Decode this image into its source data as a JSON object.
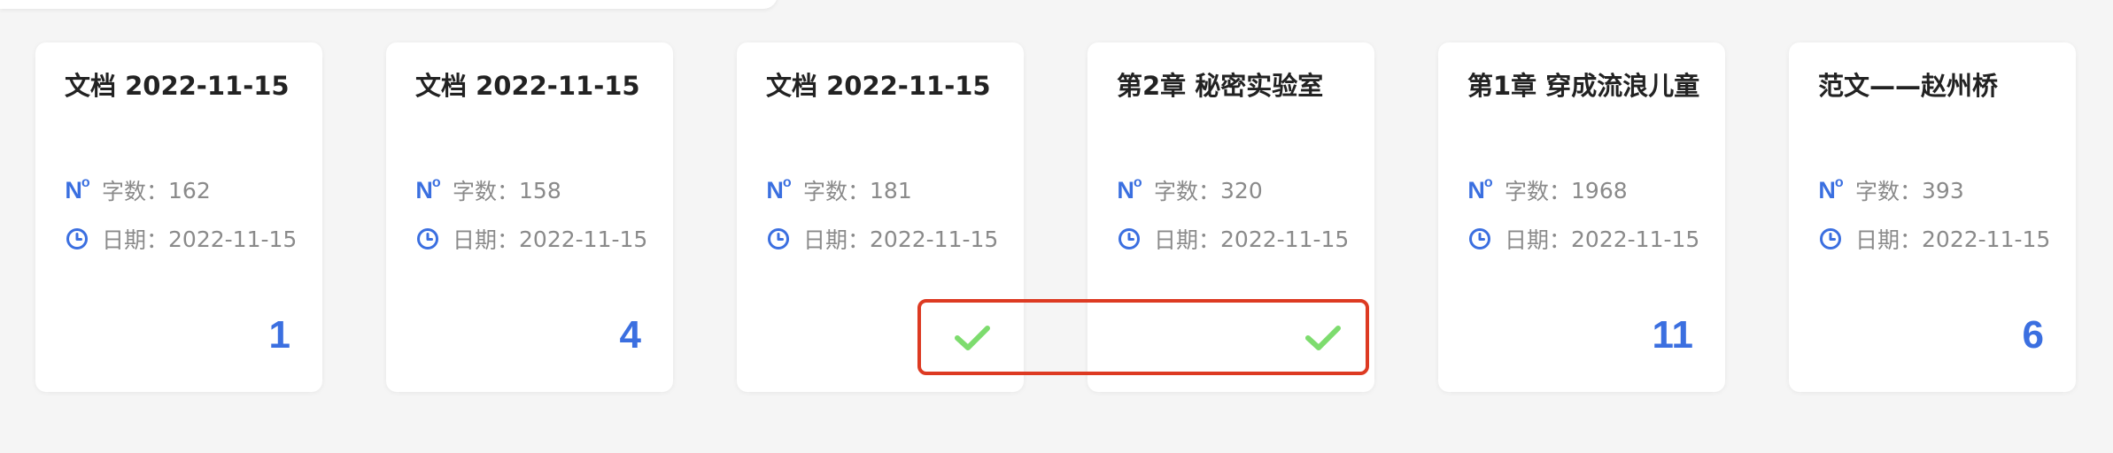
{
  "cards": [
    {
      "title": "文档 2022-11-15",
      "word_label": "字数：",
      "word_count": "162",
      "date_label": "日期：",
      "date": "2022-11-15",
      "count": "1",
      "selected": false
    },
    {
      "title": "文档 2022-11-15",
      "word_label": "字数：",
      "word_count": "158",
      "date_label": "日期：",
      "date": "2022-11-15",
      "count": "4",
      "selected": false
    },
    {
      "title": "文档 2022-11-15",
      "word_label": "字数：",
      "word_count": "181",
      "date_label": "日期：",
      "date": "2022-11-15",
      "count": "",
      "selected": true
    },
    {
      "title": "第2章 秘密实验室",
      "word_label": "字数：",
      "word_count": "320",
      "date_label": "日期：",
      "date": "2022-11-15",
      "count": "",
      "selected": true
    },
    {
      "title": "第1章 穿成流浪儿童",
      "word_label": "字数：",
      "word_count": "1968",
      "date_label": "日期：",
      "date": "2022-11-15",
      "count": "11",
      "selected": false
    },
    {
      "title": "范文——赵州桥",
      "word_label": "字数：",
      "word_count": "393",
      "date_label": "日期：",
      "date": "2022-11-15",
      "count": "6",
      "selected": false
    }
  ],
  "icons": {
    "word_count": "number-sign-icon",
    "date": "clock-icon",
    "selected": "check-icon"
  },
  "colors": {
    "accent": "#3b6fe0",
    "check": "#7ddc6e",
    "highlight": "#dd3a22",
    "meta_text": "#8a8a8a",
    "title_text": "#222222",
    "background": "#f5f5f5",
    "card": "#ffffff"
  }
}
